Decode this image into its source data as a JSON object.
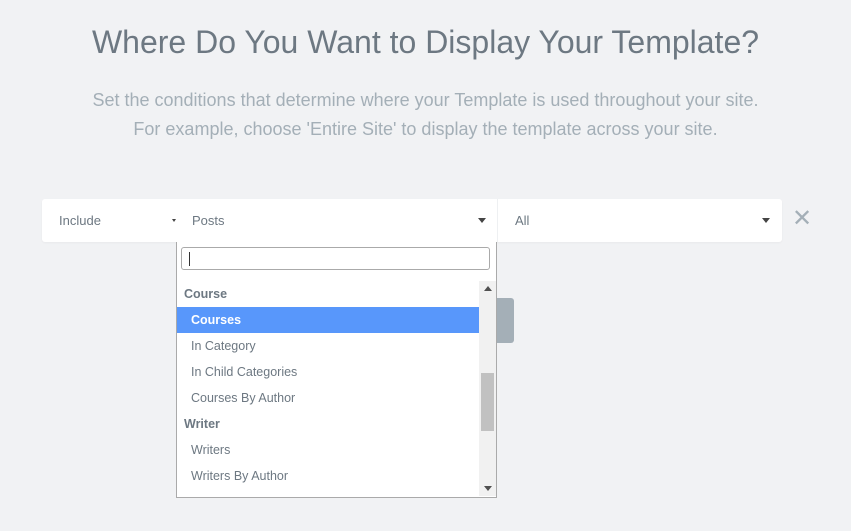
{
  "header": {
    "title": "Where Do You Want to Display Your Template?",
    "subtitle_line1": "Set the conditions that determine where your Template is used throughout your site.",
    "subtitle_line2": "For example, choose 'Entire Site' to display the template across your site."
  },
  "condition": {
    "type": "Include",
    "name": "Posts",
    "sub_name": "All",
    "remove_icon": "close-icon"
  },
  "dropdown": {
    "search_value": "",
    "groups": [
      {
        "label": "Course",
        "options": [
          "Courses",
          "In Category",
          "In Child Categories",
          "Courses By Author"
        ]
      },
      {
        "label": "Writer",
        "options": [
          "Writers",
          "Writers By Author"
        ]
      }
    ],
    "highlighted": "Courses",
    "highlight_color": "#5897fb"
  }
}
